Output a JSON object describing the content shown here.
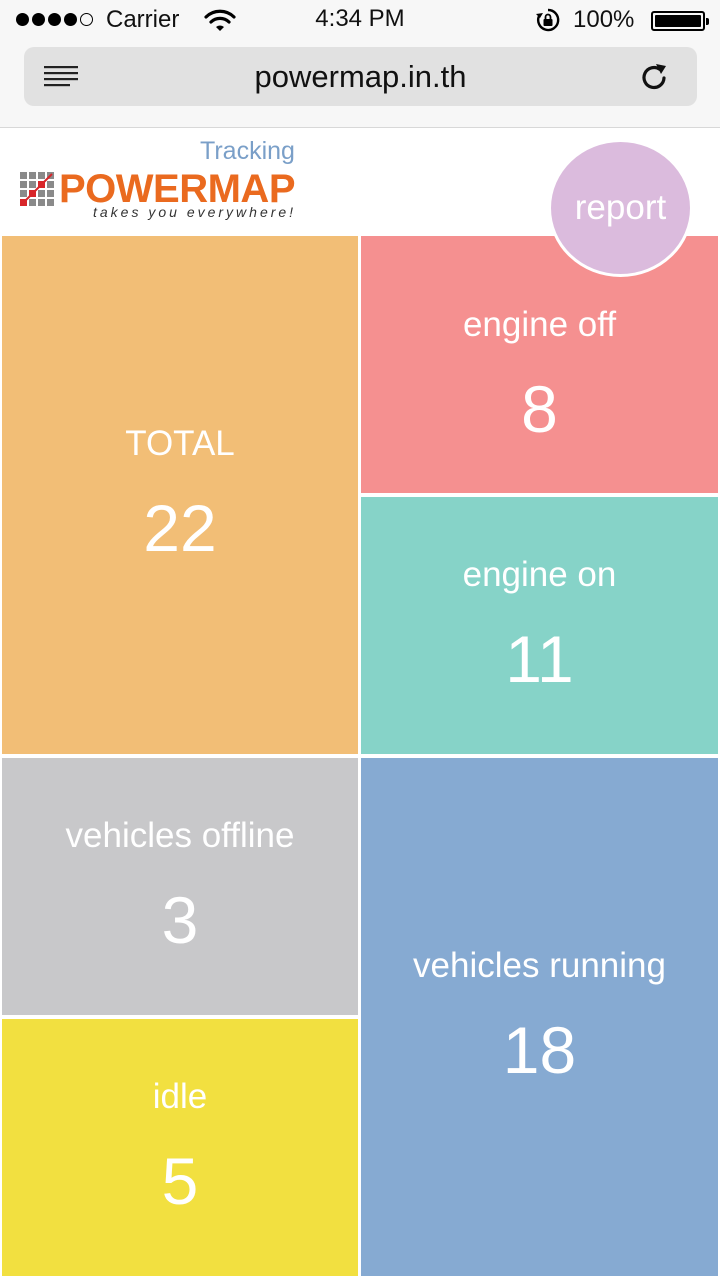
{
  "status_bar": {
    "carrier": "Carrier",
    "time": "4:34 PM",
    "battery": "100%",
    "signal_bars": 4,
    "signal_total": 5
  },
  "browser": {
    "url": "powermap.in.th",
    "icons": [
      "menu-icon",
      "reload-icon"
    ]
  },
  "header": {
    "tracking_label": "Tracking",
    "logo_text": "POWERMAP",
    "slogan": "takes you everywhere!",
    "report_label": "report"
  },
  "tiles": {
    "total": {
      "label": "TOTAL",
      "value": "22",
      "color": "#f2be76"
    },
    "engine_off": {
      "label": "engine off",
      "value": "8",
      "color": "#f59090"
    },
    "engine_on": {
      "label": "engine on",
      "value": "11",
      "color": "#86d3c8"
    },
    "offline": {
      "label": "vehicles offline",
      "value": "3",
      "color": "#c8c8ca"
    },
    "idle": {
      "label": "idle",
      "value": "5",
      "color": "#f2e040"
    },
    "running": {
      "label": "vehicles running",
      "value": "18",
      "color": "#86aad2"
    }
  },
  "colors": {
    "brand_orange": "#ea6a1f",
    "tracking_blue": "#7a9fc8",
    "report_purple": "#dbbbdd"
  }
}
